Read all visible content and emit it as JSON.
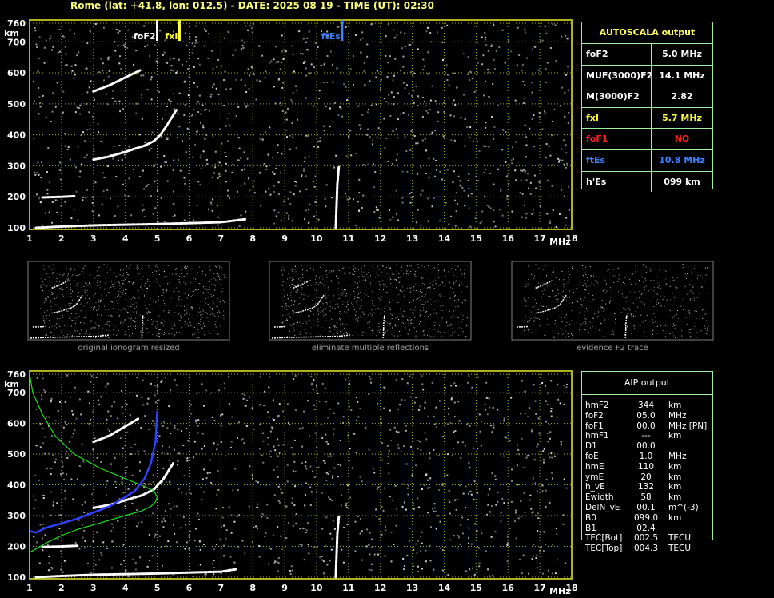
{
  "header": {
    "text": "Rome (lat: +41.8, lon: 012.5) - DATE: 2025 08 19 - TIME (UT): 02:30"
  },
  "colors": {
    "grid": "#b0b020",
    "green": "#9cf09c",
    "yellow": "#ffff40",
    "blue": "#4080ff",
    "red": "#ff2020",
    "text": "#ffffff"
  },
  "chart_data": [
    {
      "type": "scatter",
      "name_tag": "top-ionogram",
      "xlabel": "MHz",
      "ylabel": "km",
      "xlim": [
        1,
        18
      ],
      "ylim": [
        100,
        760
      ],
      "x_ticks": [
        1,
        2,
        3,
        4,
        5,
        6,
        7,
        8,
        9,
        10,
        11,
        12,
        13,
        14,
        15,
        16,
        17,
        18
      ],
      "y_ticks": [
        100,
        200,
        300,
        400,
        500,
        600,
        700,
        760
      ],
      "markers": [
        {
          "label": "foF2",
          "x": 5.0,
          "color": "#ffffff"
        },
        {
          "label": "fxI",
          "x": 5.7,
          "color": "#ffff40"
        },
        {
          "label": "ftEs",
          "x": 10.8,
          "color": "#4080ff"
        }
      ],
      "traces": [
        {
          "x": [
            1.2,
            2,
            3,
            4,
            5,
            6,
            7,
            7.8
          ],
          "y": [
            100,
            104,
            108,
            110,
            112,
            115,
            118,
            128
          ]
        },
        {
          "x": [
            1.4,
            2,
            2.4
          ],
          "y": [
            198,
            200,
            202
          ]
        },
        {
          "x": [
            3,
            3.5,
            4,
            4.3,
            4.6,
            4.9,
            5.1,
            5.3,
            5.6
          ],
          "y": [
            320,
            330,
            345,
            355,
            365,
            380,
            400,
            430,
            480
          ]
        },
        {
          "x": [
            3,
            3.5,
            4,
            4.5
          ],
          "y": [
            540,
            560,
            585,
            610
          ]
        },
        {
          "x": [
            10.6,
            10.65,
            10.7
          ],
          "y": [
            100,
            240,
            300
          ]
        }
      ]
    },
    {
      "type": "line",
      "name_tag": "bottom-ionogram",
      "xlabel": "MHz",
      "ylabel": "km",
      "xlim": [
        1,
        18
      ],
      "ylim": [
        100,
        760
      ],
      "x_ticks": [
        1,
        2,
        3,
        4,
        5,
        6,
        7,
        8,
        9,
        10,
        11,
        12,
        13,
        14,
        15,
        16,
        17,
        18
      ],
      "y_ticks": [
        100,
        200,
        300,
        400,
        500,
        600,
        700,
        760
      ],
      "series": [
        {
          "color": "#20e020",
          "x": [
            1,
            1.5,
            2,
            2.5,
            3,
            3.5,
            4,
            4.5,
            4.8,
            4.95,
            5.0,
            4.9,
            4.6,
            4.0,
            3.2,
            2.4,
            1.8,
            1.4,
            1.1,
            1.0
          ],
          "y": [
            180,
            210,
            235,
            255,
            270,
            285,
            300,
            315,
            330,
            345,
            360,
            380,
            395,
            420,
            455,
            500,
            560,
            630,
            700,
            760
          ]
        },
        {
          "color": "#3040ff",
          "x": [
            1,
            1.2,
            1.5,
            2,
            2.5,
            3,
            3.5,
            4,
            4.3,
            4.6,
            4.8,
            4.95,
            5.0
          ],
          "y": [
            250,
            245,
            260,
            275,
            290,
            310,
            330,
            360,
            380,
            420,
            470,
            540,
            640
          ]
        }
      ],
      "traces": [
        {
          "x": [
            1.2,
            2,
            3,
            4,
            5,
            6,
            7,
            7.5
          ],
          "y": [
            100,
            104,
            108,
            110,
            112,
            115,
            118,
            126
          ]
        },
        {
          "x": [
            1.4,
            2,
            2.5
          ],
          "y": [
            198,
            200,
            202
          ]
        },
        {
          "x": [
            3,
            3.5,
            4,
            4.5,
            4.9,
            5.2,
            5.5
          ],
          "y": [
            325,
            335,
            350,
            365,
            385,
            420,
            470
          ]
        },
        {
          "x": [
            3,
            3.5,
            4,
            4.4
          ],
          "y": [
            540,
            560,
            590,
            615
          ]
        },
        {
          "x": [
            10.6,
            10.65,
            10.7
          ],
          "y": [
            100,
            240,
            300
          ]
        }
      ]
    }
  ],
  "autoscala": {
    "title": "AUTOSCALA output",
    "rows": [
      {
        "label": "foF2",
        "value": "5.0 MHz",
        "color": "#ffffff"
      },
      {
        "label": "MUF(3000)F2",
        "value": "14.1 MHz",
        "color": "#ffffff"
      },
      {
        "label": "M(3000)F2",
        "value": "2.82",
        "color": "#ffffff"
      },
      {
        "label": "fxI",
        "value": "5.7 MHz",
        "color": "#ffff40"
      },
      {
        "label": "foF1",
        "value": "NO",
        "color": "#ff2020"
      },
      {
        "label": "ftEs",
        "value": "10.8 MHz",
        "color": "#4080ff"
      },
      {
        "label": "h'Es",
        "value": "099    km",
        "color": "#ffffff"
      }
    ]
  },
  "thumbnails": [
    {
      "caption": "original ionogram resized"
    },
    {
      "caption": "eliminate multiple reflections"
    },
    {
      "caption": "evidence F2 trace"
    }
  ],
  "aip": {
    "title": "AIP output",
    "rows": [
      {
        "name": "hmF2",
        "value": "344",
        "unit": "km"
      },
      {
        "name": "foF2",
        "value": "05.0",
        "unit": "MHz"
      },
      {
        "name": "foF1",
        "value": "00.0",
        "unit": "MHz   [PN]"
      },
      {
        "name": "hmF1",
        "value": "---",
        "unit": "km"
      },
      {
        "name": "D1",
        "value": "00.0",
        "unit": ""
      },
      {
        "name": "foE",
        "value": "1.0",
        "unit": "MHz"
      },
      {
        "name": "hmE",
        "value": "110",
        "unit": "km"
      },
      {
        "name": "ymE",
        "value": "20",
        "unit": "km"
      },
      {
        "name": "h_vE",
        "value": "132",
        "unit": "km"
      },
      {
        "name": "Ewidth",
        "value": "58",
        "unit": "km"
      },
      {
        "name": "DelN_vE",
        "value": "00.1",
        "unit": "m^(-3)"
      },
      {
        "name": "B0",
        "value": "099.0",
        "unit": "km"
      },
      {
        "name": "B1",
        "value": "02.4",
        "unit": ""
      },
      {
        "name": "TEC[Bot]",
        "value": "002.5",
        "unit": "TECU"
      },
      {
        "name": "TEC[Top]",
        "value": "004.3",
        "unit": "TECU"
      }
    ]
  }
}
